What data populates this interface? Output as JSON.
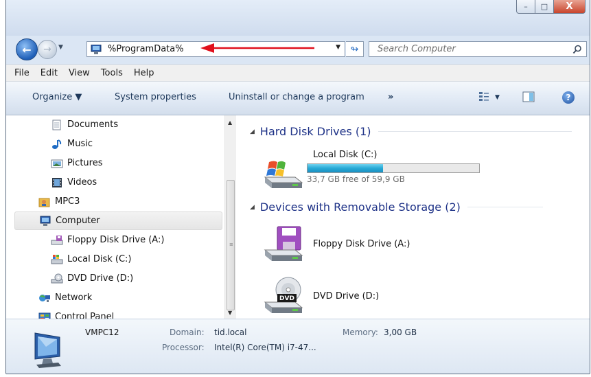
{
  "window": {
    "buttons": {
      "minimize": "–",
      "maximize": "□",
      "close": "X"
    }
  },
  "nav": {
    "back_symbol": "←",
    "forward_symbol": "→",
    "address": "%ProgramData%",
    "search_placeholder": "Search Computer"
  },
  "menu": [
    "File",
    "Edit",
    "View",
    "Tools",
    "Help"
  ],
  "toolbar": {
    "organize": "Organize ▼",
    "system_properties": "System properties",
    "uninstall": "Uninstall or change a program",
    "more": "»",
    "views_drop": "▼",
    "help": "?"
  },
  "sidebar": {
    "items": [
      {
        "label": "Documents",
        "icon": "documents-icon"
      },
      {
        "label": "Music",
        "icon": "music-icon"
      },
      {
        "label": "Pictures",
        "icon": "pictures-icon"
      },
      {
        "label": "Videos",
        "icon": "videos-icon"
      },
      {
        "label": "MPC3",
        "icon": "user-folder-icon"
      },
      {
        "label": "Computer",
        "icon": "computer-icon",
        "selected": true
      },
      {
        "label": "Floppy Disk Drive (A:)",
        "icon": "floppy-drive-icon"
      },
      {
        "label": "Local Disk (C:)",
        "icon": "local-disk-icon"
      },
      {
        "label": "DVD Drive (D:)",
        "icon": "dvd-drive-icon"
      },
      {
        "label": "Network",
        "icon": "network-icon"
      },
      {
        "label": "Control Panel",
        "icon": "control-panel-icon"
      }
    ]
  },
  "main": {
    "group_hdd": "Hard Disk Drives (1)",
    "local_disk": {
      "name": "Local Disk (C:)",
      "free": "33,7 GB free of 59,9 GB",
      "used_fraction": 0.44
    },
    "group_removable": "Devices with Removable Storage (2)",
    "floppy": "Floppy Disk Drive (A:)",
    "dvd": "DVD Drive (D:)",
    "dvd_badge": "DVD"
  },
  "details": {
    "computer_name": "VMPC12",
    "domain_label": "Domain:",
    "domain_value": "tid.local",
    "memory_label": "Memory:",
    "memory_value": "3,00 GB",
    "processor_label": "Processor:",
    "processor_value": "Intel(R) Core(TM) i7-47..."
  },
  "colors": {
    "accent": "#1e3287",
    "arrow": "#e0101c",
    "progress": "#27a9d6"
  }
}
